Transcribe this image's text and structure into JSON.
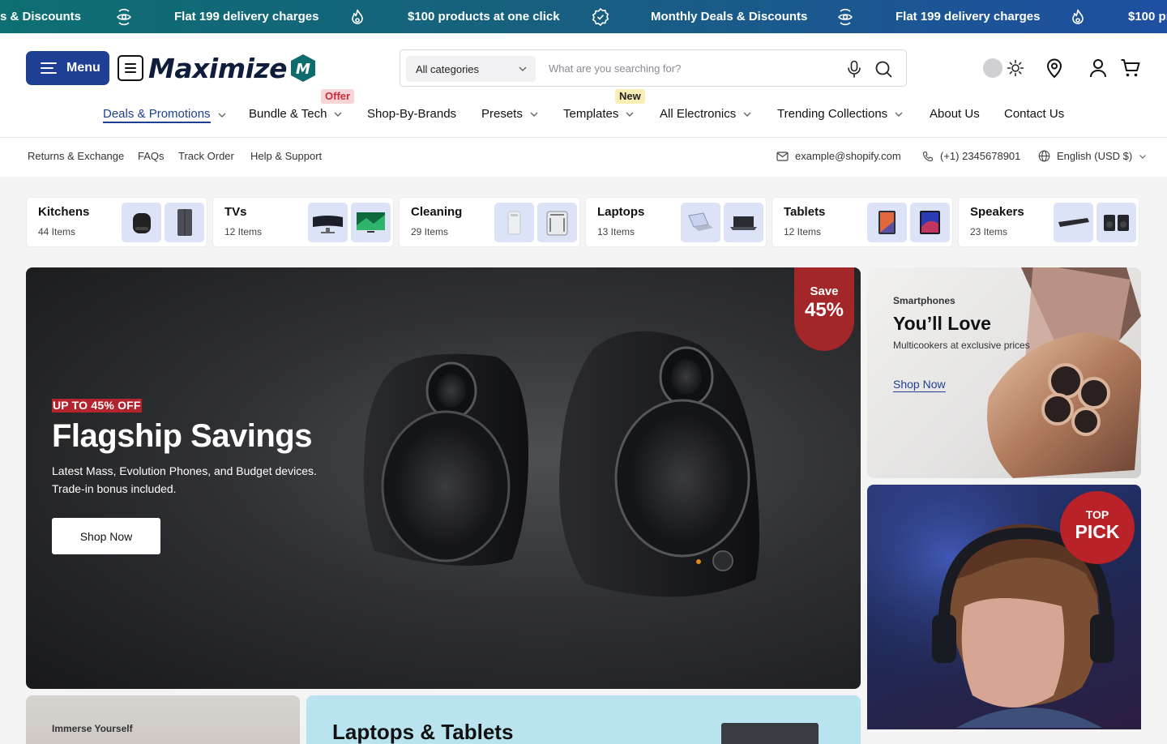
{
  "ticker": {
    "items": [
      "s & Discounts",
      "Flat 199 delivery charges",
      "$100 products at one click",
      "Monthly Deals & Discounts",
      "Flat 199 delivery charges",
      "$100 pro"
    ],
    "icons": [
      "eye-rotate-icon",
      "flame-icon",
      "check-badge-icon",
      "eye-rotate-icon",
      "flame-icon"
    ]
  },
  "header": {
    "menu_label": "Menu",
    "logo_text": "Maximize",
    "logo_mark": "M",
    "search": {
      "category": "All categories",
      "placeholder": "What are you searching for?"
    }
  },
  "nav": {
    "items": [
      {
        "label": "Deals & Promotions",
        "dropdown": true
      },
      {
        "label": "Bundle & Tech",
        "dropdown": true
      },
      {
        "label": "Shop-By-Brands",
        "dropdown": false
      },
      {
        "label": "Presets",
        "dropdown": true
      },
      {
        "label": "Templates",
        "dropdown": true
      },
      {
        "label": "All Electronics",
        "dropdown": true
      },
      {
        "label": "Trending Collections",
        "dropdown": true
      },
      {
        "label": "About Us",
        "dropdown": false
      },
      {
        "label": "Contact Us",
        "dropdown": false
      }
    ],
    "tag_offer": "Offer",
    "tag_new": "New"
  },
  "subbar": {
    "links": [
      "Returns & Exchange",
      "FAQs",
      "Track Order",
      "Help & Support"
    ],
    "email": "example@shopify.com",
    "phone": "(+1) 2345678901",
    "language": "English (USD $)"
  },
  "categories": [
    {
      "name": "Kitchens",
      "count": "44 Items"
    },
    {
      "name": "TVs",
      "count": "12 Items"
    },
    {
      "name": "Cleaning",
      "count": "29 Items"
    },
    {
      "name": "Laptops",
      "count": "13 Items"
    },
    {
      "name": "Tablets",
      "count": "12 Items"
    },
    {
      "name": "Speakers",
      "count": "23 Items"
    }
  ],
  "hero": {
    "kicker": "UP TO 45% OFF",
    "title": "Flagship Savings",
    "desc": "Latest Mass, Evolution Phones, and Budget devices. Trade-in bonus included.",
    "button": "Shop Now",
    "badge_top": "Save",
    "badge_value": "45%"
  },
  "promo_phones": {
    "kicker": "Smartphones",
    "title": "You’ll Love",
    "desc": "Multicookers at exclusive prices",
    "link": "Shop Now"
  },
  "promo_gaming": {
    "badge_top": "TOP",
    "badge_main": "PICK"
  },
  "bottom_left": {
    "kicker": "Immerse Yourself"
  },
  "bottom_right": {
    "title": "Laptops & Tablets"
  },
  "colors": {
    "brand": "#1f3f95",
    "accent_red": "#a32628",
    "ticker_start": "#0d6f72",
    "ticker_end": "#1f4fa1"
  }
}
